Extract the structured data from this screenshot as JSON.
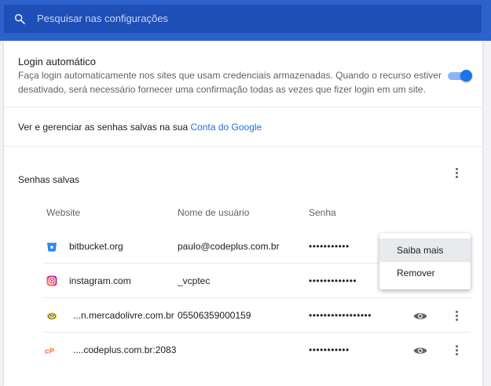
{
  "search": {
    "placeholder": "Pesquisar nas configurações"
  },
  "auto_login": {
    "title": "Login automático",
    "description_line1": "Faça login automaticamente nos sites que usam credenciais armazenadas. Quando o recurso estiver",
    "description_line2": "desativado, será necessário fornecer uma confirmação todas as vezes que fizer login em um site.",
    "enabled": true
  },
  "manage_link": {
    "text": "Ver e gerenciar as senhas salvas na sua ",
    "link_text": "Conta do Google"
  },
  "saved_passwords": {
    "title": "Senhas salvas",
    "columns": {
      "website": "Website",
      "username": "Nome de usuário",
      "password": "Senha"
    },
    "rows": [
      {
        "website": "bitbucket.org",
        "username": "paulo@codeplus.com.br",
        "password": "•••••••••••",
        "icon": "bitbucket-icon"
      },
      {
        "website": "instagram.com",
        "username": "_vcptec",
        "password": "•••••••••••••",
        "icon": "instagram-icon"
      },
      {
        "website": "...n.mercadolivre.com.br",
        "username": "05506359000159",
        "password": "•••••••••••••••••",
        "icon": "mercadolivre-icon"
      },
      {
        "website": "....codeplus.com.br:2083",
        "username": "",
        "password": "•••••••••••",
        "icon": "cpanel-icon"
      }
    ]
  },
  "context_menu": {
    "items": [
      "Saiba mais",
      "Remover"
    ],
    "hovered": "Saiba mais"
  },
  "colors": {
    "accent": "#1a73e8",
    "header": "#2d62cc"
  }
}
